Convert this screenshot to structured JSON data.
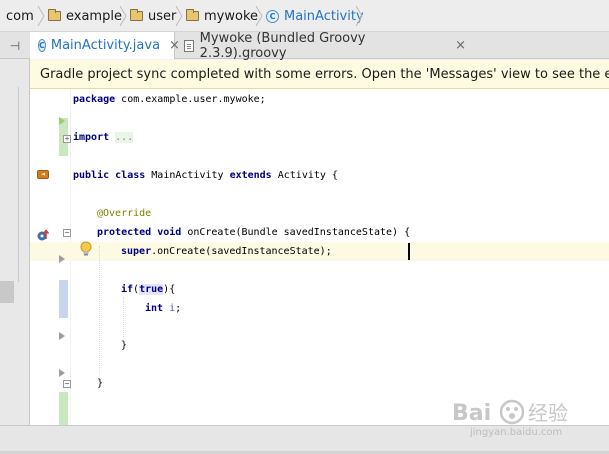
{
  "breadcrumb": {
    "items": [
      {
        "label": "com",
        "icon": "folder-icon"
      },
      {
        "label": "example",
        "icon": "folder-icon"
      },
      {
        "label": "user",
        "icon": "folder-icon"
      },
      {
        "label": "mywoke",
        "icon": "folder-icon"
      },
      {
        "label": "MainActivity",
        "icon": "class-icon",
        "active": true
      }
    ],
    "class_icon_letter": "C"
  },
  "tabs": [
    {
      "label": "MainActivity.java",
      "icon": "class-icon",
      "active": true,
      "close": "×"
    },
    {
      "label": "Mywoke (Bundled Groovy 2.3.9).groovy",
      "icon": "groovy-file-icon",
      "active": false,
      "close": "×"
    }
  ],
  "tab_control": "⊣",
  "banner": {
    "text": "Gradle project sync completed with some errors. Open the 'Messages' view to see the errors four"
  },
  "code": {
    "package_kw": "package",
    "package_name": " com.example.user.mywoke;",
    "import_kw": "import",
    "import_fold": "...",
    "class_line": {
      "kw1": "public",
      "kw2": "class",
      "name": " MainActivity ",
      "kw3": "extends",
      "parent": " Activity {"
    },
    "annotation": "@Override",
    "method_line": {
      "kw1": "protected",
      "kw2": "void",
      "rest": " onCreate(Bundle savedInstanceState) {"
    },
    "super_line": {
      "kw": "super",
      "rest": ".onCreate(savedInstanceState);"
    },
    "if_line": {
      "kw": "if",
      "open": "(",
      "cond": "true",
      "close": "){"
    },
    "int_line": {
      "kw": "int",
      "var": " i",
      "end": ";"
    },
    "close_brace_if": "}",
    "close_brace_method": "}"
  },
  "colors": {
    "keyword": "#000080",
    "annotation": "#808000",
    "active_link": "#2473c2",
    "banner_bg": "#fffbe0",
    "caret_line": "#fcfae3"
  },
  "watermark": {
    "brand": "Bai",
    "brand2": "经验",
    "url": "jingyan.baidu.com"
  }
}
